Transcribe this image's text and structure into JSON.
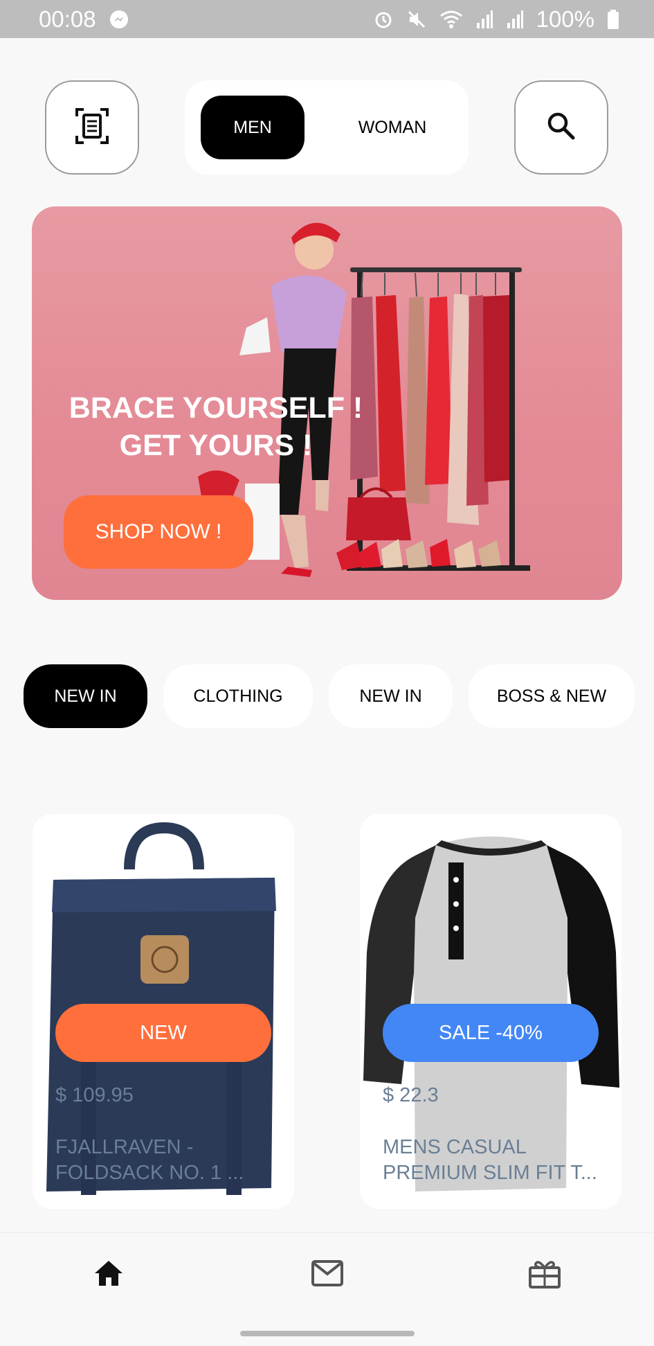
{
  "status_bar": {
    "time": "00:08",
    "battery": "100%",
    "icons": [
      "messenger-icon",
      "alarm-icon",
      "mute-icon",
      "wifi-icon",
      "signal-icon",
      "signal-icon",
      "battery-icon"
    ]
  },
  "header": {
    "scan_icon": "scan-document-icon",
    "search_icon": "search-icon",
    "gender_tabs": [
      {
        "label": "MEN",
        "active": true
      },
      {
        "label": "WOMAN",
        "active": false
      }
    ]
  },
  "banner": {
    "headline_line1": "BRACE YOURSELF !",
    "headline_line2": "GET YOURS !",
    "button_label": "SHOP NOW !"
  },
  "categories": [
    {
      "label": "NEW IN",
      "active": true
    },
    {
      "label": "CLOTHING",
      "active": false
    },
    {
      "label": "NEW IN",
      "active": false
    },
    {
      "label": "BOSS & NEW",
      "active": false
    }
  ],
  "products": [
    {
      "badge": "NEW",
      "badge_color": "#ff6f3c",
      "price": "$ 109.95",
      "title_line1": "FJALLRAVEN -",
      "title_line2": "FOLDSACK NO. 1 ..."
    },
    {
      "badge": "SALE -40%",
      "badge_color": "#4287f5",
      "price": "$ 22.3",
      "title_line1": "MENS CASUAL",
      "title_line2": "PREMIUM SLIM FIT T..."
    }
  ],
  "bottom_nav": [
    {
      "icon": "home-icon",
      "active": true
    },
    {
      "icon": "mail-icon",
      "active": false
    },
    {
      "icon": "gift-icon",
      "active": false
    }
  ],
  "colors": {
    "accent_orange": "#ff6f3c",
    "accent_blue": "#4287f5",
    "banner_pink": "#e48b96",
    "text_muted": "#6a7f95"
  }
}
